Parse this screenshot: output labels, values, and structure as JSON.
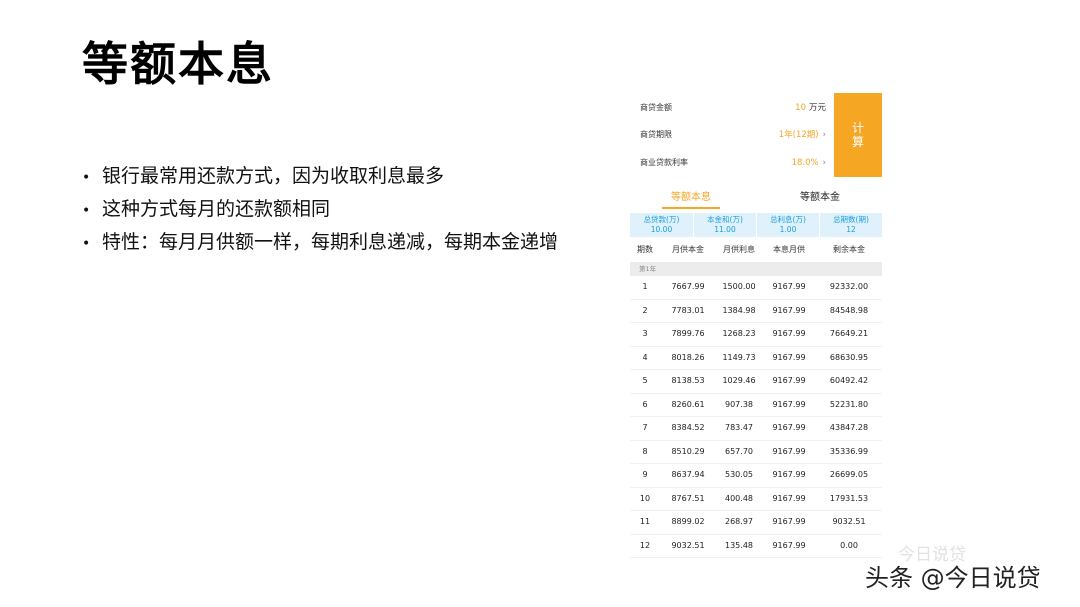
{
  "slide": {
    "title": "等额本息",
    "bullets": [
      "银行最常用还款方式，因为收取利息最多",
      "这种方式每月的还款额相同",
      "特性：每月月供额一样，每期利息递减，每期本金递增"
    ]
  },
  "phone": {
    "form": {
      "amount_label": "商贷金额",
      "amount_value": "10",
      "amount_unit": "万元",
      "term_label": "商贷期限",
      "term_value": "1年(12期)",
      "rate_label": "商业贷款利率",
      "rate_value": "18.0%",
      "calc_button": "计算"
    },
    "tabs": [
      "等额本息",
      "等额本金"
    ],
    "summary": [
      {
        "label": "总贷款(万)",
        "value": "10.00"
      },
      {
        "label": "本金和(万)",
        "value": "11.00"
      },
      {
        "label": "总利息(万)",
        "value": "1.00"
      },
      {
        "label": "总期数(期)",
        "value": "12"
      }
    ],
    "table": {
      "headers": [
        "期数",
        "月供本金",
        "月供利息",
        "本息月供",
        "剩余本金"
      ],
      "year_label": "第1年",
      "rows": [
        [
          "1",
          "7667.99",
          "1500.00",
          "9167.99",
          "92332.00"
        ],
        [
          "2",
          "7783.01",
          "1384.98",
          "9167.99",
          "84548.98"
        ],
        [
          "3",
          "7899.76",
          "1268.23",
          "9167.99",
          "76649.21"
        ],
        [
          "4",
          "8018.26",
          "1149.73",
          "9167.99",
          "68630.95"
        ],
        [
          "5",
          "8138.53",
          "1029.46",
          "9167.99",
          "60492.42"
        ],
        [
          "6",
          "8260.61",
          "907.38",
          "9167.99",
          "52231.80"
        ],
        [
          "7",
          "8384.52",
          "783.47",
          "9167.99",
          "43847.28"
        ],
        [
          "8",
          "8510.29",
          "657.70",
          "9167.99",
          "35336.99"
        ],
        [
          "9",
          "8637.94",
          "530.05",
          "9167.99",
          "26699.05"
        ],
        [
          "10",
          "8767.51",
          "400.48",
          "9167.99",
          "17931.53"
        ],
        [
          "11",
          "8899.02",
          "268.97",
          "9167.99",
          "9032.51"
        ],
        [
          "12",
          "9032.51",
          "135.48",
          "9167.99",
          "0.00"
        ]
      ]
    }
  },
  "watermark": {
    "sub_text": "今日说贷",
    "text": "头条 @今日说贷"
  },
  "colors": {
    "accent": "#f5a623",
    "summary_bg": "#dff1fa",
    "summary_text": "#1a9ee0"
  }
}
